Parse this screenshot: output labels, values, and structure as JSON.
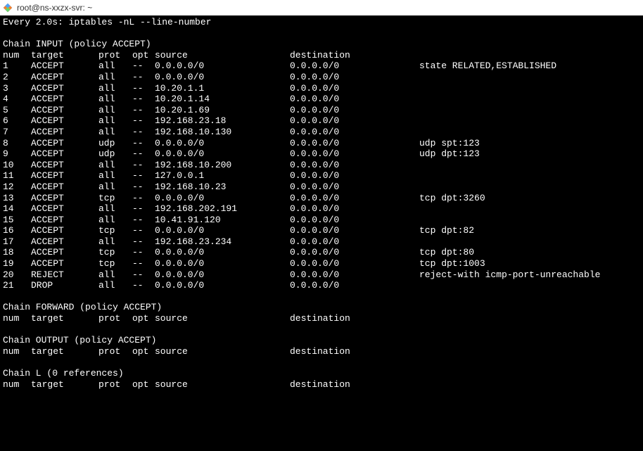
{
  "titlebar": {
    "text": "root@ns-xxzx-svr: ~"
  },
  "watch_line": "Every 2.0s: iptables -nL --line-number",
  "chains": [
    {
      "header": "Chain INPUT (policy ACCEPT)",
      "cols": {
        "num": "num",
        "target": "target",
        "prot": "prot",
        "opt": "opt",
        "source": "source",
        "destination": "destination"
      },
      "rules": [
        {
          "num": "1",
          "target": "ACCEPT",
          "prot": "all",
          "opt": "--",
          "source": "0.0.0.0/0",
          "destination": "0.0.0.0/0",
          "extra": "state RELATED,ESTABLISHED"
        },
        {
          "num": "2",
          "target": "ACCEPT",
          "prot": "all",
          "opt": "--",
          "source": "0.0.0.0/0",
          "destination": "0.0.0.0/0",
          "extra": ""
        },
        {
          "num": "3",
          "target": "ACCEPT",
          "prot": "all",
          "opt": "--",
          "source": "10.20.1.1",
          "destination": "0.0.0.0/0",
          "extra": ""
        },
        {
          "num": "4",
          "target": "ACCEPT",
          "prot": "all",
          "opt": "--",
          "source": "10.20.1.14",
          "destination": "0.0.0.0/0",
          "extra": ""
        },
        {
          "num": "5",
          "target": "ACCEPT",
          "prot": "all",
          "opt": "--",
          "source": "10.20.1.69",
          "destination": "0.0.0.0/0",
          "extra": ""
        },
        {
          "num": "6",
          "target": "ACCEPT",
          "prot": "all",
          "opt": "--",
          "source": "192.168.23.18",
          "destination": "0.0.0.0/0",
          "extra": ""
        },
        {
          "num": "7",
          "target": "ACCEPT",
          "prot": "all",
          "opt": "--",
          "source": "192.168.10.130",
          "destination": "0.0.0.0/0",
          "extra": ""
        },
        {
          "num": "8",
          "target": "ACCEPT",
          "prot": "udp",
          "opt": "--",
          "source": "0.0.0.0/0",
          "destination": "0.0.0.0/0",
          "extra": "udp spt:123"
        },
        {
          "num": "9",
          "target": "ACCEPT",
          "prot": "udp",
          "opt": "--",
          "source": "0.0.0.0/0",
          "destination": "0.0.0.0/0",
          "extra": "udp dpt:123"
        },
        {
          "num": "10",
          "target": "ACCEPT",
          "prot": "all",
          "opt": "--",
          "source": "192.168.10.200",
          "destination": "0.0.0.0/0",
          "extra": ""
        },
        {
          "num": "11",
          "target": "ACCEPT",
          "prot": "all",
          "opt": "--",
          "source": "127.0.0.1",
          "destination": "0.0.0.0/0",
          "extra": ""
        },
        {
          "num": "12",
          "target": "ACCEPT",
          "prot": "all",
          "opt": "--",
          "source": "192.168.10.23",
          "destination": "0.0.0.0/0",
          "extra": ""
        },
        {
          "num": "13",
          "target": "ACCEPT",
          "prot": "tcp",
          "opt": "--",
          "source": "0.0.0.0/0",
          "destination": "0.0.0.0/0",
          "extra": "tcp dpt:3260"
        },
        {
          "num": "14",
          "target": "ACCEPT",
          "prot": "all",
          "opt": "--",
          "source": "192.168.202.191",
          "destination": "0.0.0.0/0",
          "extra": ""
        },
        {
          "num": "15",
          "target": "ACCEPT",
          "prot": "all",
          "opt": "--",
          "source": "10.41.91.120",
          "destination": "0.0.0.0/0",
          "extra": ""
        },
        {
          "num": "16",
          "target": "ACCEPT",
          "prot": "tcp",
          "opt": "--",
          "source": "0.0.0.0/0",
          "destination": "0.0.0.0/0",
          "extra": "tcp dpt:82"
        },
        {
          "num": "17",
          "target": "ACCEPT",
          "prot": "all",
          "opt": "--",
          "source": "192.168.23.234",
          "destination": "0.0.0.0/0",
          "extra": ""
        },
        {
          "num": "18",
          "target": "ACCEPT",
          "prot": "tcp",
          "opt": "--",
          "source": "0.0.0.0/0",
          "destination": "0.0.0.0/0",
          "extra": "tcp dpt:80"
        },
        {
          "num": "19",
          "target": "ACCEPT",
          "prot": "tcp",
          "opt": "--",
          "source": "0.0.0.0/0",
          "destination": "0.0.0.0/0",
          "extra": "tcp dpt:1003"
        },
        {
          "num": "20",
          "target": "REJECT",
          "prot": "all",
          "opt": "--",
          "source": "0.0.0.0/0",
          "destination": "0.0.0.0/0",
          "extra": "reject-with icmp-port-unreachable"
        },
        {
          "num": "21",
          "target": "DROP",
          "prot": "all",
          "opt": "--",
          "source": "0.0.0.0/0",
          "destination": "0.0.0.0/0",
          "extra": ""
        }
      ]
    },
    {
      "header": "Chain FORWARD (policy ACCEPT)",
      "cols": {
        "num": "num",
        "target": "target",
        "prot": "prot",
        "opt": "opt",
        "source": "source",
        "destination": "destination"
      },
      "rules": []
    },
    {
      "header": "Chain OUTPUT (policy ACCEPT)",
      "cols": {
        "num": "num",
        "target": "target",
        "prot": "prot",
        "opt": "opt",
        "source": "source",
        "destination": "destination"
      },
      "rules": []
    },
    {
      "header": "Chain L (0 references)",
      "cols": {
        "num": "num",
        "target": "target",
        "prot": "prot",
        "opt": "opt",
        "source": "source",
        "destination": "destination"
      },
      "rules": []
    }
  ]
}
